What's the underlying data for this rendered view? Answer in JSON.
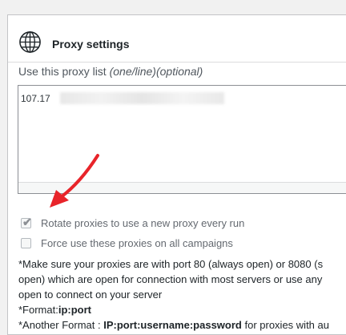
{
  "section": {
    "title": "Proxy settings",
    "icon": "globe-icon"
  },
  "proxy_list": {
    "label": "Use this proxy list ",
    "label_hint": "(one/line)(optional)",
    "value": "107.17"
  },
  "options": [
    {
      "label": "Rotate proxies to use a new proxy every run",
      "checked": true
    },
    {
      "label": "Force use these proxies on all campaigns",
      "checked": false
    }
  ],
  "note": {
    "line1": "*Make sure your proxies are with port 80 (always open) or 8080 (s",
    "line2": "open) which are open for connection with most servers or use any",
    "line3": "open to connect on your server",
    "format_prefix": "*Format:",
    "format_value": "ip:port",
    "another_prefix": "*Another Format : ",
    "another_value": "IP:port:username:password",
    "another_suffix": " for proxies with au"
  },
  "colors": {
    "annotation_arrow": "#e8242a",
    "panel_border": "#c3c4c7"
  }
}
